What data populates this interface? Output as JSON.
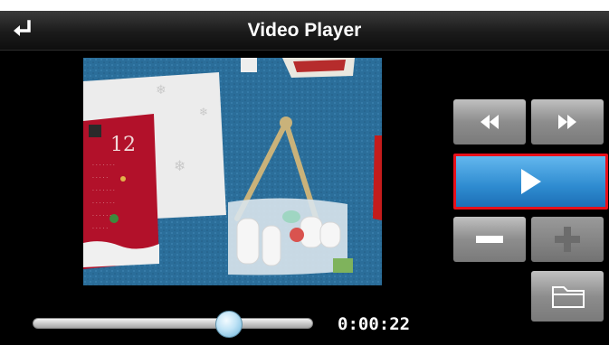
{
  "header": {
    "title": "Video Player",
    "back_icon": "back-arrow-icon"
  },
  "video": {
    "calendar_day": "12"
  },
  "controls": {
    "rewind_icon": "rewind-icon",
    "fast_forward_icon": "fast-forward-icon",
    "play_icon": "play-icon",
    "volume_down_icon": "minus-icon",
    "volume_up_icon": "plus-icon",
    "folder_icon": "folder-icon"
  },
  "playback": {
    "elapsed_time": "0:00:22",
    "progress_fraction": 0.7
  },
  "colors": {
    "header_bg": "#1b1b1b",
    "play_button_bg": "#2e8bd0",
    "selection_border": "#e8101a",
    "control_button_bg": "#8d8d8d"
  }
}
